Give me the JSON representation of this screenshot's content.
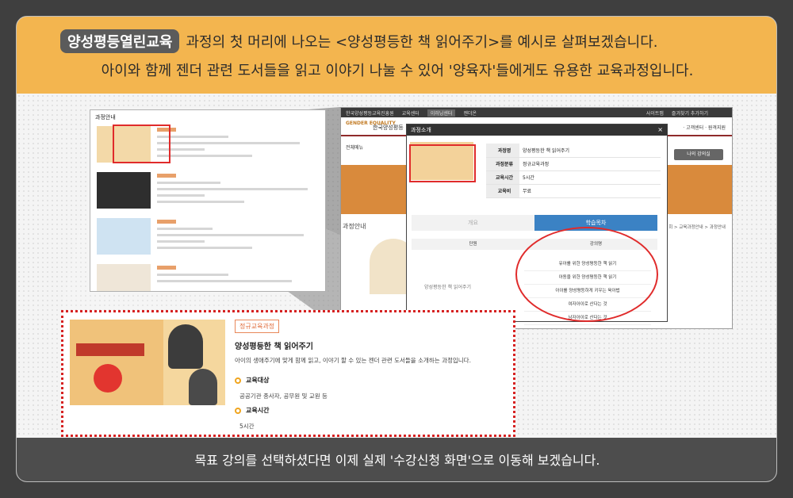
{
  "header": {
    "badge": "양성평등열린교육",
    "line1_rest": "과정의 첫 머리에 나오는 <양성평등한 책 읽어주기>를 예시로 살펴보겠습니다.",
    "line2": "아이와 함께 젠더 관련 도서들을 읽고 이야기 나눌 수 있어 '양육자'들에게도 유용한 교육과정입니다."
  },
  "left_page": {
    "title": "과정안내"
  },
  "site": {
    "topbar": [
      "한국양성평등교육진흥원",
      "교육센터",
      "이러닝센터",
      "젠더온"
    ],
    "topbar_active": "이러닝센터",
    "topbar_right": [
      "사이트맵",
      "즐겨찾기 추가하기"
    ],
    "logo": "GENDER EQUALITY",
    "site_name": "한국양성평등",
    "nav_right": "· 고객센터 · 원격지원",
    "menu": "전체메뉴",
    "my_lecture": "나의 강의실",
    "course_heading": "과정안내",
    "breadcrumb": "회 > 교육과정안내 > 과정안내"
  },
  "modal": {
    "title": "과정소개",
    "close": "×",
    "info": [
      {
        "label": "과정명",
        "value": "양성평등한 책 읽어주기"
      },
      {
        "label": "과정분류",
        "value": "정규교육과정"
      },
      {
        "label": "교육시간",
        "value": "5시간"
      },
      {
        "label": "교육비",
        "value": "무료"
      }
    ],
    "tab_overview": "개요",
    "tab_contents": "학습목차",
    "col_unit": "단원",
    "col_lesson": "강의명",
    "unit_name": "양성평등한 책 읽어주기",
    "lessons": [
      "유아를 위한 양성평등한 책 읽기",
      "아동을 위한 양성평등한 책 읽기",
      "아이를 양성평등하게 키우는 육아법",
      "여자아이로 산다는 것",
      "남자아이로 산다는 것"
    ]
  },
  "detail": {
    "tag": "정규교육과정",
    "title": "양성평등한 책 읽어주기",
    "description": "아이의 생애주기에 맞게 함께 읽고, 이야기 할 수 있는 젠더 관련 도서들을 소개하는 과정입니다.",
    "target_label": "교육대상",
    "target_value": "공공기관 종사자, 공무원 및 교원 등",
    "time_label": "교육시간",
    "time_value": "5시간"
  },
  "footer": {
    "text": "목표 강의를 선택하셨다면 이제 실제 '수강신청 화면'으로 이동해 보겠습니다."
  },
  "colors": {
    "header_bg": "#f3b54f",
    "footer_bg": "#4d4d4d",
    "highlight": "#e02b2b",
    "tab_active": "#3b82c4"
  }
}
